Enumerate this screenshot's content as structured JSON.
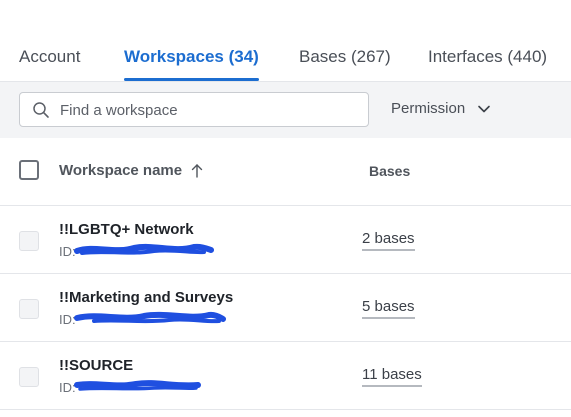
{
  "tabs": [
    {
      "label": "Account",
      "active": false
    },
    {
      "label": "Workspaces (34)",
      "active": true
    },
    {
      "label": "Bases (267)",
      "active": false
    },
    {
      "label": "Interfaces (440)",
      "active": false
    }
  ],
  "search": {
    "placeholder": "Find a workspace",
    "value": ""
  },
  "filters": {
    "permission_label": "Permission"
  },
  "table": {
    "columns": {
      "name": "Workspace name",
      "bases": "Bases"
    },
    "rows": [
      {
        "name": "!!LGBTQ+ Network",
        "id_prefix": "ID:",
        "bases": "2 bases"
      },
      {
        "name": "!!Marketing and Surveys",
        "id_prefix": "ID:",
        "bases": "5 bases"
      },
      {
        "name": "!!SOURCE",
        "id_prefix": "ID:",
        "bases": "11 bases"
      }
    ]
  },
  "colors": {
    "accent": "#1c6dd0",
    "redaction": "#1f4fe0",
    "toolbar_bg": "#f3f4f6"
  },
  "icons": {
    "search": "search-icon",
    "permission_dropdown": "chevron-down-icon",
    "sort": "arrow-up-icon"
  }
}
